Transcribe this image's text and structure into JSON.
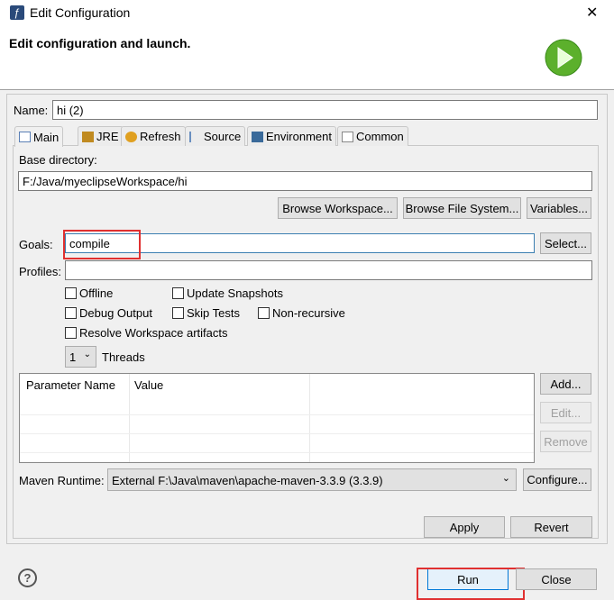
{
  "window": {
    "title": "Edit Configuration",
    "close": "✕"
  },
  "header": {
    "title": "Edit configuration and launch."
  },
  "name": {
    "label": "Name:",
    "value": "hi (2)"
  },
  "tabs": [
    {
      "label": "Main",
      "color": "#5a7fb5"
    },
    {
      "label": "JRE",
      "color": "#c08a20"
    },
    {
      "label": "Refresh",
      "color": "#e0a020"
    },
    {
      "label": "Source",
      "color": "#6a8fc0"
    },
    {
      "label": "Environment",
      "color": "#3a6a9a"
    },
    {
      "label": "Common",
      "color": "#888888"
    }
  ],
  "main": {
    "base_dir_label": "Base directory:",
    "base_dir_value": "F:/Java/myeclipseWorkspace/hi",
    "browse_workspace": "Browse Workspace...",
    "browse_fs": "Browse File System...",
    "variables": "Variables...",
    "goals_label": "Goals:",
    "goals_value": "compile",
    "select": "Select...",
    "profiles_label": "Profiles:",
    "profiles_value": "",
    "checkboxes": {
      "offline": "Offline",
      "update": "Update Snapshots",
      "debug": "Debug Output",
      "skip": "Skip Tests",
      "nonrec": "Non-recursive",
      "resolve": "Resolve Workspace artifacts"
    },
    "threads_value": "1",
    "threads_label": "Threads",
    "table": {
      "col1": "Parameter Name",
      "col2": "Value"
    },
    "add": "Add...",
    "edit": "Edit...",
    "remove": "Remove",
    "runtime_label": "Maven Runtime:",
    "runtime_value": "External F:\\Java\\maven\\apache-maven-3.3.9 (3.3.9)",
    "configure": "Configure...",
    "apply": "Apply",
    "revert": "Revert"
  },
  "footer": {
    "help": "?",
    "run": "Run",
    "close": "Close"
  }
}
